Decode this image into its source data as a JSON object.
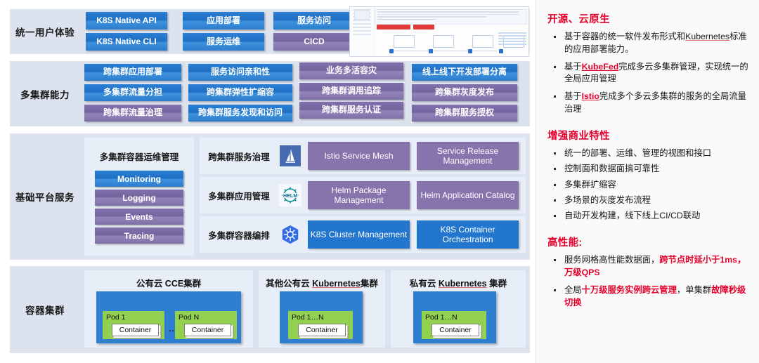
{
  "diagram": {
    "bands": [
      {
        "id": "unified-user-experience",
        "label": "统一用户体验",
        "chips": [
          {
            "text": "K8S Native API",
            "color": "blue"
          },
          {
            "text": "K8S Native CLI",
            "color": "blue"
          },
          {
            "text": "应用部署",
            "color": "blue"
          },
          {
            "text": "服务运维",
            "color": "blue"
          },
          {
            "text": "服务访问",
            "color": "blue"
          },
          {
            "text": "CICD",
            "color": "purple"
          }
        ]
      },
      {
        "id": "multi-cluster-capability",
        "label": "多集群能力",
        "chips": [
          {
            "text": "跨集群应用部署",
            "color": "blue"
          },
          {
            "text": "多集群流量分担",
            "color": "blue"
          },
          {
            "text": "跨集群流量治理",
            "color": "purple"
          },
          {
            "text": "服务访问亲和性",
            "color": "blue"
          },
          {
            "text": "跨集群弹性扩缩容",
            "color": "blue"
          },
          {
            "text": "跨集群服务发现和访问",
            "color": "blue"
          },
          {
            "text": "业务多活容灾",
            "color": "purple"
          },
          {
            "text": "跨集群调用追踪",
            "color": "purple"
          },
          {
            "text": "跨集群服务认证",
            "color": "purple"
          },
          {
            "text": "线上线下开发部署分离",
            "color": "blue"
          },
          {
            "text": "跨集群灰度发布",
            "color": "purple"
          },
          {
            "text": "跨集群服务授权",
            "color": "purple"
          }
        ]
      },
      {
        "id": "base-platform-service",
        "label": "基础平台服务",
        "ops": {
          "title": "多集群容器运维管理",
          "items": [
            {
              "text": "Monitoring",
              "color": "blue"
            },
            {
              "text": "Logging",
              "color": "purple"
            },
            {
              "text": "Events",
              "color": "purple"
            },
            {
              "text": "Tracing",
              "color": "purple"
            }
          ]
        },
        "rows": [
          {
            "title": "跨集群服务治理",
            "icon": "istio-icon",
            "cards": [
              {
                "text": "Istio Service Mesh",
                "color": "purple"
              },
              {
                "text": "Service Release Management",
                "color": "purple"
              }
            ]
          },
          {
            "title": "多集群应用管理",
            "icon": "helm-icon",
            "cards": [
              {
                "text": "Helm Package Management",
                "color": "purple"
              },
              {
                "text": "Helm Application Catalog",
                "color": "purple"
              }
            ]
          },
          {
            "title": "多集群容器编排",
            "icon": "kubernetes-icon",
            "cards": [
              {
                "text": "K8S Cluster Management",
                "color": "blue"
              },
              {
                "text": "K8S Container Orchestration",
                "color": "blue"
              }
            ]
          }
        ]
      },
      {
        "id": "container-cluster",
        "label": "容器集群",
        "clusters": [
          {
            "title_plain": "公有云 CCE集群",
            "pods": [
              {
                "label": "Pod 1",
                "container": "Container"
              },
              {
                "label": "Pod N",
                "container": "Container"
              }
            ],
            "separator": "…"
          },
          {
            "title_pre": "其他公有云 ",
            "title_underline": "Kubernetes",
            "title_post": "集群",
            "pods": [
              {
                "label": "Pod 1…N",
                "container": "Container"
              }
            ]
          },
          {
            "title_pre": "私有云 ",
            "title_underline": "Kubernetes",
            "title_post": " 集群",
            "pods": [
              {
                "label": "Pod 1…N",
                "container": "Container"
              }
            ]
          }
        ]
      }
    ],
    "thumbnail": {
      "name": "console-screenshot-thumbnail"
    }
  },
  "sidebar": {
    "sections": [
      {
        "heading": "开源、云原生",
        "bullets": [
          {
            "parts": [
              {
                "t": "基于容器的统一软件发布形式和",
                "s": "plain"
              },
              {
                "t": "Kubernetes",
                "s": "underline"
              },
              {
                "t": "标准的应用部署能力。",
                "s": "plain"
              }
            ]
          },
          {
            "parts": [
              {
                "t": "基于",
                "s": "plain"
              },
              {
                "t": "KubeFed",
                "s": "red-underline"
              },
              {
                "t": "完成多云多集群管理，实现统一的全局应用管理",
                "s": "plain"
              }
            ]
          },
          {
            "parts": [
              {
                "t": "基于",
                "s": "plain"
              },
              {
                "t": "Istio",
                "s": "red-underline"
              },
              {
                "t": "完成多个多云多集群的服务的全局流量治理",
                "s": "plain"
              }
            ]
          }
        ]
      },
      {
        "heading": "增强商业特性",
        "bullets": [
          {
            "parts": [
              {
                "t": "统一的部署、运维、管理的视图和接口",
                "s": "plain"
              }
            ]
          },
          {
            "parts": [
              {
                "t": "控制面和数据面搞可靠性",
                "s": "plain"
              }
            ]
          },
          {
            "parts": [
              {
                "t": "多集群扩缩容",
                "s": "plain"
              }
            ]
          },
          {
            "parts": [
              {
                "t": "多场景的灰度发布流程",
                "s": "plain"
              }
            ]
          },
          {
            "parts": [
              {
                "t": "自动开发构建，线下线上CI/CD联动",
                "s": "plain"
              }
            ]
          }
        ]
      },
      {
        "heading": "高性能:",
        "bullets": [
          {
            "parts": [
              {
                "t": "服务网格高性能数据面，",
                "s": "plain"
              },
              {
                "t": "跨节点时延小于1ms，万级QPS",
                "s": "red"
              }
            ]
          },
          {
            "parts": [
              {
                "t": "全局",
                "s": "plain"
              },
              {
                "t": "十万级服务实例跨云管理",
                "s": "red"
              },
              {
                "t": "，单集群",
                "s": "plain"
              },
              {
                "t": "故障秒级切换",
                "s": "red"
              }
            ]
          }
        ]
      }
    ]
  },
  "colors": {
    "blue": "#2276cd",
    "purple": "#8874ac",
    "band_bg": "#dce2ee",
    "inner_bg": "#e8eef8",
    "accent_red": "#e4002b",
    "pod_green": "#92d050",
    "cluster_blue": "#2f7fd0"
  }
}
